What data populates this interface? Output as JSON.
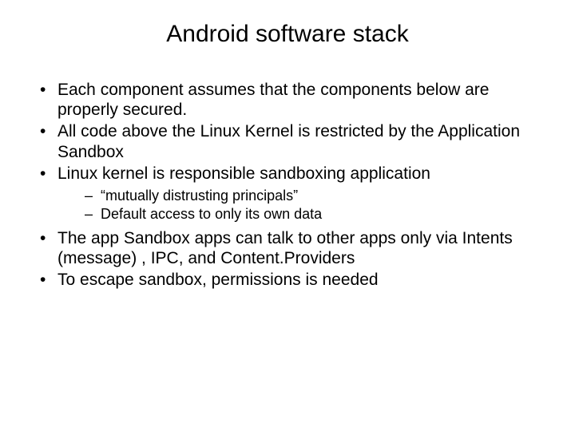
{
  "title": "Android software stack",
  "bullets": {
    "b0": "Each component assumes that the components below are properly secured.",
    "b1": "All code above the Linux Kernel is restricted by the Application Sandbox",
    "b2": "Linux  kernel  is  responsible sandboxing application",
    "b2_sub0": "“mutually distrusting principals”",
    "b2_sub1": "Default access to only its own data",
    "b3": "The  app Sandbox apps  can  talk  to  other  apps  only  via   Intents (message) , IPC, and Content.Providers",
    "b4": "To  escape  sandbox,  permissions is needed"
  }
}
